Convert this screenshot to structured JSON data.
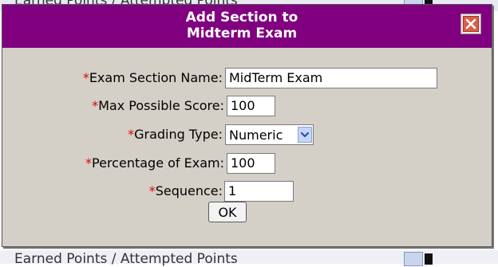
{
  "background": {
    "top_text": "Earned Points / Attempted Points",
    "bottom_text": "Earned Points / Attempted Points"
  },
  "dialog": {
    "title_line1": "Add Section to",
    "title_line2": "Midterm Exam",
    "required_mark": "*",
    "fields": {
      "section_name_label": "Exam Section Name:",
      "section_name_value": "MidTerm Exam",
      "max_score_label": "Max Possible Score:",
      "max_score_value": "100",
      "grading_type_label": "Grading Type:",
      "grading_type_value": "Numeric",
      "percentage_label": "Percentage of Exam:",
      "percentage_value": "100",
      "sequence_label": "Sequence:",
      "sequence_value": "1"
    },
    "ok_label": "OK"
  },
  "colors": {
    "titlebar": "#800080",
    "dialog_bg": "#d4d0c8",
    "required": "#e00000"
  },
  "icons": {
    "close": "close-x-icon",
    "dropdown": "chevron-down-icon"
  }
}
